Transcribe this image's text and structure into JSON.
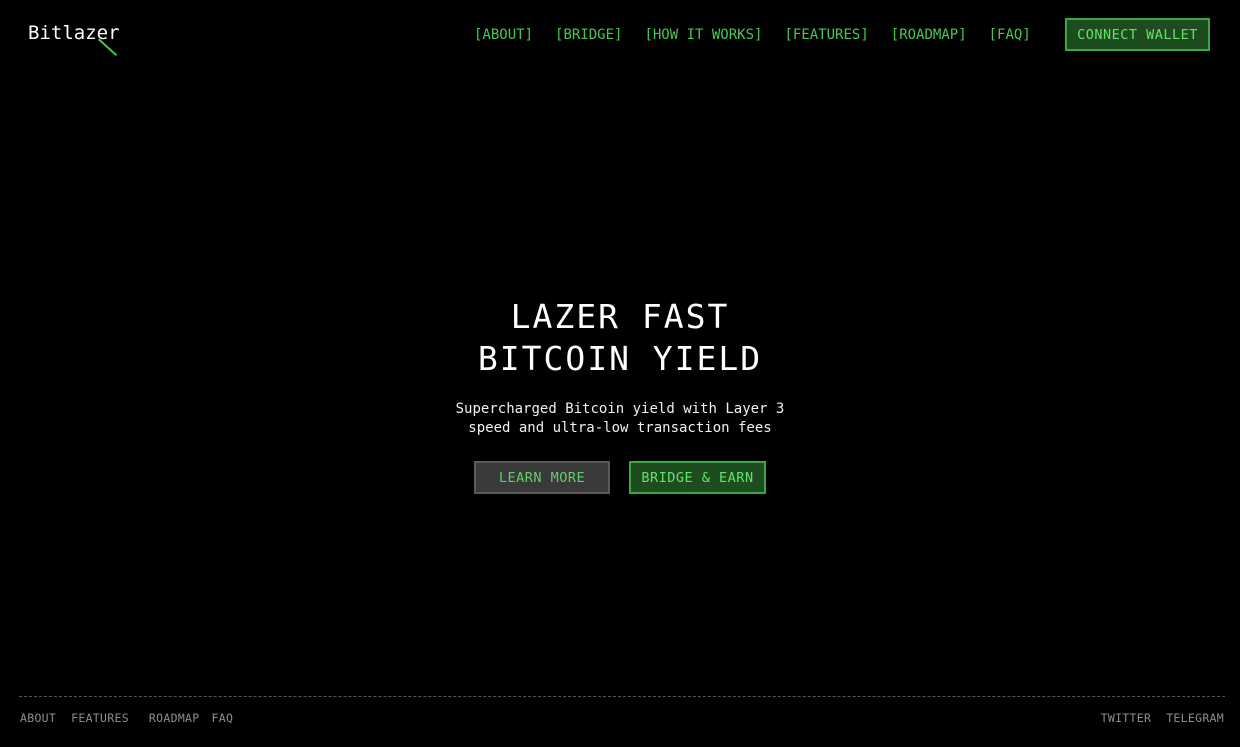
{
  "brand": {
    "logo_text": "Bitlazer"
  },
  "nav": {
    "items": [
      {
        "label": "[ABOUT]"
      },
      {
        "label": "[BRIDGE]"
      },
      {
        "label": "[HOW IT WORKS]"
      },
      {
        "label": "[FEATURES]"
      },
      {
        "label": "[ROADMAP]"
      },
      {
        "label": "[FAQ]"
      }
    ],
    "connect_wallet_label": "CONNECT WALLET"
  },
  "hero": {
    "title_line1": "LAZER FAST",
    "title_line2": "BITCOIN YIELD",
    "subtitle_line1": "Supercharged Bitcoin yield with Layer 3",
    "subtitle_line2": "speed and ultra-low transaction fees",
    "learn_more_label": "LEARN MORE",
    "bridge_earn_label": "BRIDGE & EARN"
  },
  "footer": {
    "left_links": [
      {
        "label": "ABOUT"
      },
      {
        "label": "FEATURES"
      },
      {
        "label": "ROADMAP"
      },
      {
        "label": "FAQ"
      }
    ],
    "right_links": [
      {
        "label": "TWITTER"
      },
      {
        "label": "TELEGRAM"
      }
    ]
  },
  "colors": {
    "background": "#000000",
    "accent_green": "#47c84f",
    "button_green_bg": "#1d4d1f",
    "button_gray_bg": "#3a3a3a",
    "footer_text": "#8c8c8c"
  }
}
